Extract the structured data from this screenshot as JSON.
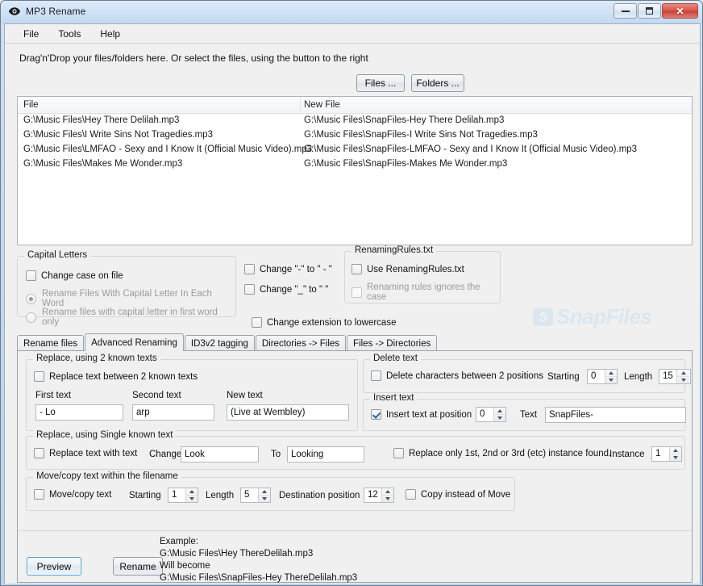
{
  "window": {
    "title": "MP3 Rename",
    "app_icon": "eye-icon",
    "minimize_label": "Minimize",
    "maximize_label": "Maximize",
    "close_label": "✕"
  },
  "menubar": {
    "items": [
      {
        "label": "File"
      },
      {
        "label": "Tools"
      },
      {
        "label": "Help"
      }
    ]
  },
  "toolbar": {
    "drop_hint": "Drag'n'Drop your files/folders here. Or select the files, using the button to the right",
    "files_button": "Files ...",
    "folders_button": "Folders ..."
  },
  "file_list": {
    "columns": [
      "File",
      "New File"
    ],
    "rows": [
      {
        "file": "G:\\Music Files\\Hey There Delilah.mp3",
        "new_file": "G:\\Music Files\\SnapFiles-Hey There Delilah.mp3"
      },
      {
        "file": "G:\\Music Files\\I Write Sins Not Tragedies.mp3",
        "new_file": "G:\\Music Files\\SnapFiles-I Write Sins Not Tragedies.mp3"
      },
      {
        "file": "G:\\Music Files\\LMFAO - Sexy and I Know It (Official Music Video).mp3",
        "new_file": "G:\\Music Files\\SnapFiles-LMFAO - Sexy and I Know It (Official Music Video).mp3"
      },
      {
        "file": "G:\\Music Files\\Makes Me Wonder.mp3",
        "new_file": "G:\\Music Files\\SnapFiles-Makes Me Wonder.mp3"
      }
    ]
  },
  "capital_letters": {
    "legend": "Capital Letters",
    "change_case_label": "Change case on file",
    "change_case_checked": false,
    "radio_each_word": "Rename Files With Capital Letter In Each Word",
    "radio_first_word": "Rename files with capital letter in first word only",
    "radio_selected": "each_word"
  },
  "char_options": {
    "change_dash_label": "Change \"-\" to \" - \"",
    "change_dash_checked": false,
    "change_underscore_label": "Change \"_\" to \" \"",
    "change_underscore_checked": false,
    "change_extension_label": "Change extension to lowercase",
    "change_extension_checked": false
  },
  "renaming_rules": {
    "legend": "RenamingRules.txt",
    "use_rules_label": "Use RenamingRules.txt",
    "use_rules_checked": false,
    "ignore_case_label": "Renaming rules ignores the case",
    "ignore_case_checked": false
  },
  "watermark": {
    "text": "SnapFiles",
    "badge": "S"
  },
  "tabs": {
    "items": [
      {
        "label": "Rename files",
        "active": false
      },
      {
        "label": "Advanced Renaming",
        "active": true
      },
      {
        "label": "ID3v2 tagging",
        "active": false
      },
      {
        "label": "Directories -> Files",
        "active": false
      },
      {
        "label": "Files -> Directories",
        "active": false
      }
    ]
  },
  "replace_two": {
    "legend": "Replace, using 2 known texts",
    "checkbox_label": "Replace text between 2 known texts",
    "checked": false,
    "first_label": "First text",
    "first_value": "- Lo",
    "second_label": "Second text",
    "second_value": "arp",
    "new_label": "New text",
    "new_value": "(Live at Wembley)"
  },
  "delete_text": {
    "legend": "Delete text",
    "checkbox_label": "Delete characters between 2 positions",
    "checked": false,
    "starting_label": "Starting",
    "starting_value": "0",
    "length_label": "Length",
    "length_value": "15"
  },
  "insert_text": {
    "legend": "Insert text",
    "checkbox_label": "Insert text at position",
    "checked": true,
    "position_value": "0",
    "text_label": "Text",
    "text_value": "SnapFiles-"
  },
  "replace_single": {
    "legend": "Replace, using Single known text",
    "checkbox_label": "Replace text with text",
    "checked": false,
    "change_label": "Change",
    "change_value": "Look",
    "to_label": "To",
    "to_value": "Looking",
    "instance_checkbox_label": "Replace only 1st, 2nd or 3rd (etc) instance found.",
    "instance_checked": false,
    "instance_label": "Instance",
    "instance_value": "1"
  },
  "move_copy": {
    "legend": "Move/copy text within the filename",
    "checkbox_label": "Move/copy text",
    "checked": false,
    "starting_label": "Starting",
    "starting_value": "1",
    "length_label": "Length",
    "length_value": "5",
    "destination_label": "Destination position",
    "destination_value": "12",
    "copy_label": "Copy instead of Move",
    "copy_checked": false
  },
  "footer": {
    "preview_button": "Preview",
    "rename_button": "Rename",
    "example_line1": "Example:",
    "example_line2": "G:\\Music Files\\Hey ThereDelilah.mp3",
    "example_line3": "Will become",
    "example_line4": "G:\\Music Files\\SnapFiles-Hey ThereDelilah.mp3"
  },
  "colors": {
    "accent": "#2763a8",
    "close_button": "#c63f33",
    "watermark": "#dbe6ef"
  }
}
